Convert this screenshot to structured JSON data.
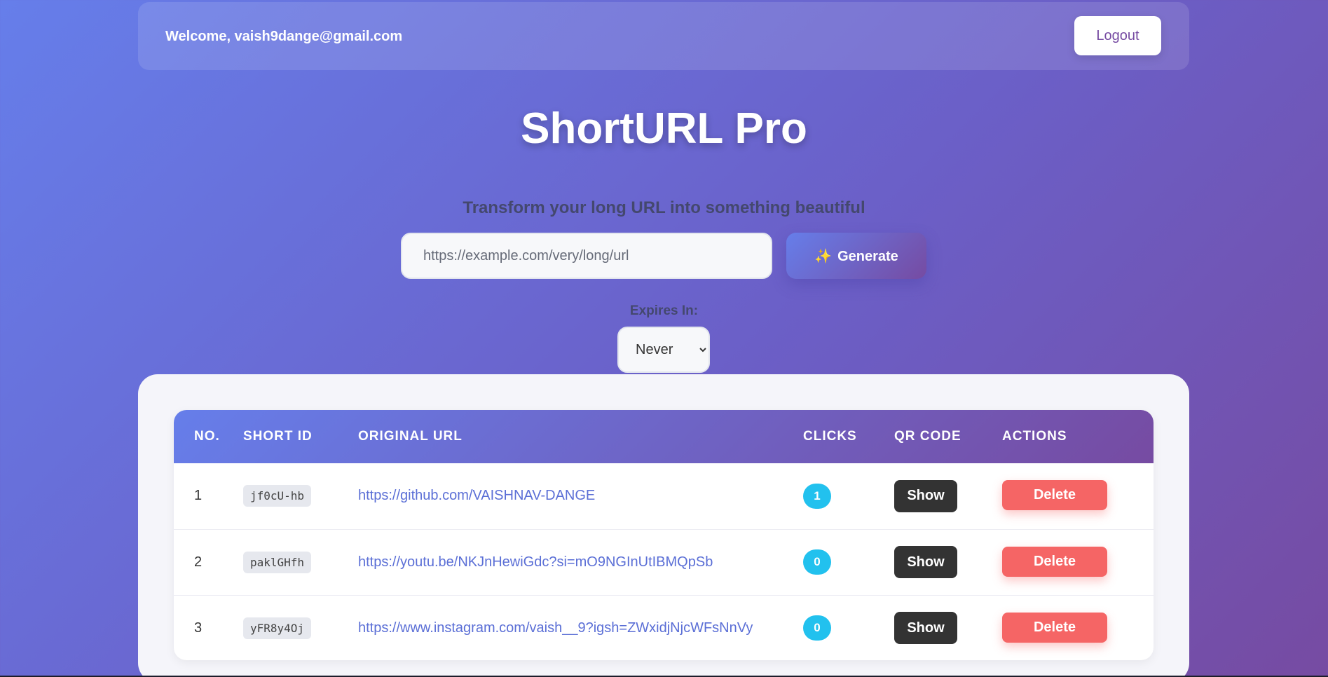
{
  "header": {
    "welcome_text": "Welcome, vaish9dange@gmail.com",
    "logout_label": "Logout"
  },
  "app": {
    "title": "ShortURL Pro",
    "subtitle": "Transform your long URL into something beautiful"
  },
  "form": {
    "url_placeholder": "https://example.com/very/long/url",
    "generate_icon": "✨",
    "generate_label": "Generate",
    "expires_label": "Expires In:",
    "expires_selected": "Never"
  },
  "table": {
    "columns": [
      "NO.",
      "SHORT ID",
      "ORIGINAL URL",
      "CLICKS",
      "QR CODE",
      "ACTIONS"
    ],
    "rows": [
      {
        "no": "1",
        "short_id": "jf0cU-hb",
        "url": "https://github.com/VAISHNAV-DANGE",
        "clicks": "1",
        "qr_label": "Show",
        "action_label": "Delete"
      },
      {
        "no": "2",
        "short_id": "paklGHfh",
        "url": "https://youtu.be/NKJnHewiGdc?si=mO9NGInUtIBMQpSb",
        "clicks": "0",
        "qr_label": "Show",
        "action_label": "Delete"
      },
      {
        "no": "3",
        "short_id": "yFR8y4Oj",
        "url": "https://www.instagram.com/vaish__9?igsh=ZWxidjNjcWFsNnVy",
        "clicks": "0",
        "qr_label": "Show",
        "action_label": "Delete"
      }
    ]
  },
  "colors": {
    "gradient_start": "#667eea",
    "gradient_end": "#764ba2",
    "delete": "#f56565",
    "clicks_badge": "#22c1ee",
    "link": "#5b6fd6"
  }
}
